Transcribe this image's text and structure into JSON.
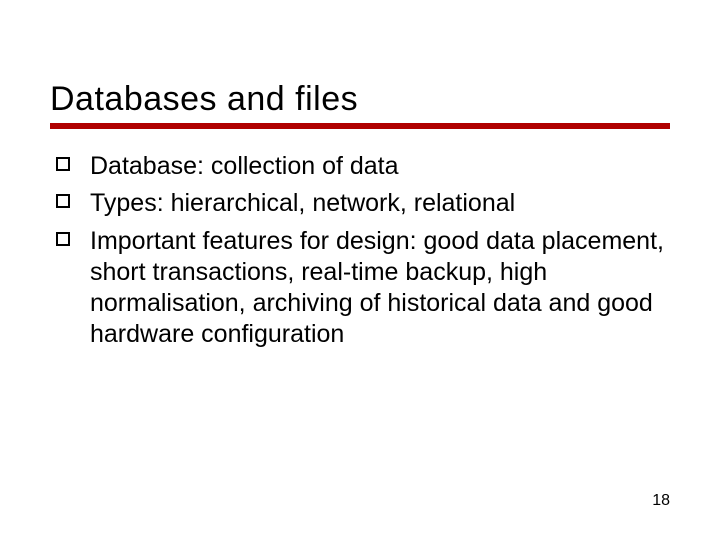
{
  "title": "Databases and files",
  "bullets": [
    "Database: collection of data",
    "Types: hierarchical, network, relational",
    "Important features for design: good data placement, short transactions, real-time backup, high normalisation, archiving of historical data and good hardware configuration"
  ],
  "page_number": "18"
}
